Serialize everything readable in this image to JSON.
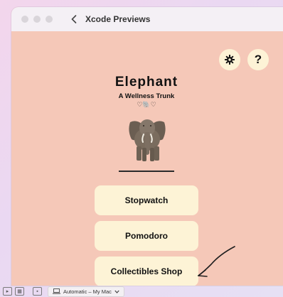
{
  "window": {
    "title": "Xcode Previews"
  },
  "toolbar": {
    "settings_icon": "gear-icon",
    "help_label": "?"
  },
  "app": {
    "title": "Elephant",
    "subtitle": "A Wellness Trunk",
    "emoji_row": "♡🐘♡"
  },
  "menu": {
    "items": [
      "Stopwatch",
      "Pomodoro",
      "Collectibles Shop"
    ]
  },
  "bottom_bar": {
    "device_label": "Automatic – My Mac"
  },
  "colors": {
    "background": "#f5c8b8",
    "button": "#fdf3d6",
    "titlebar": "#f4f0f5"
  }
}
